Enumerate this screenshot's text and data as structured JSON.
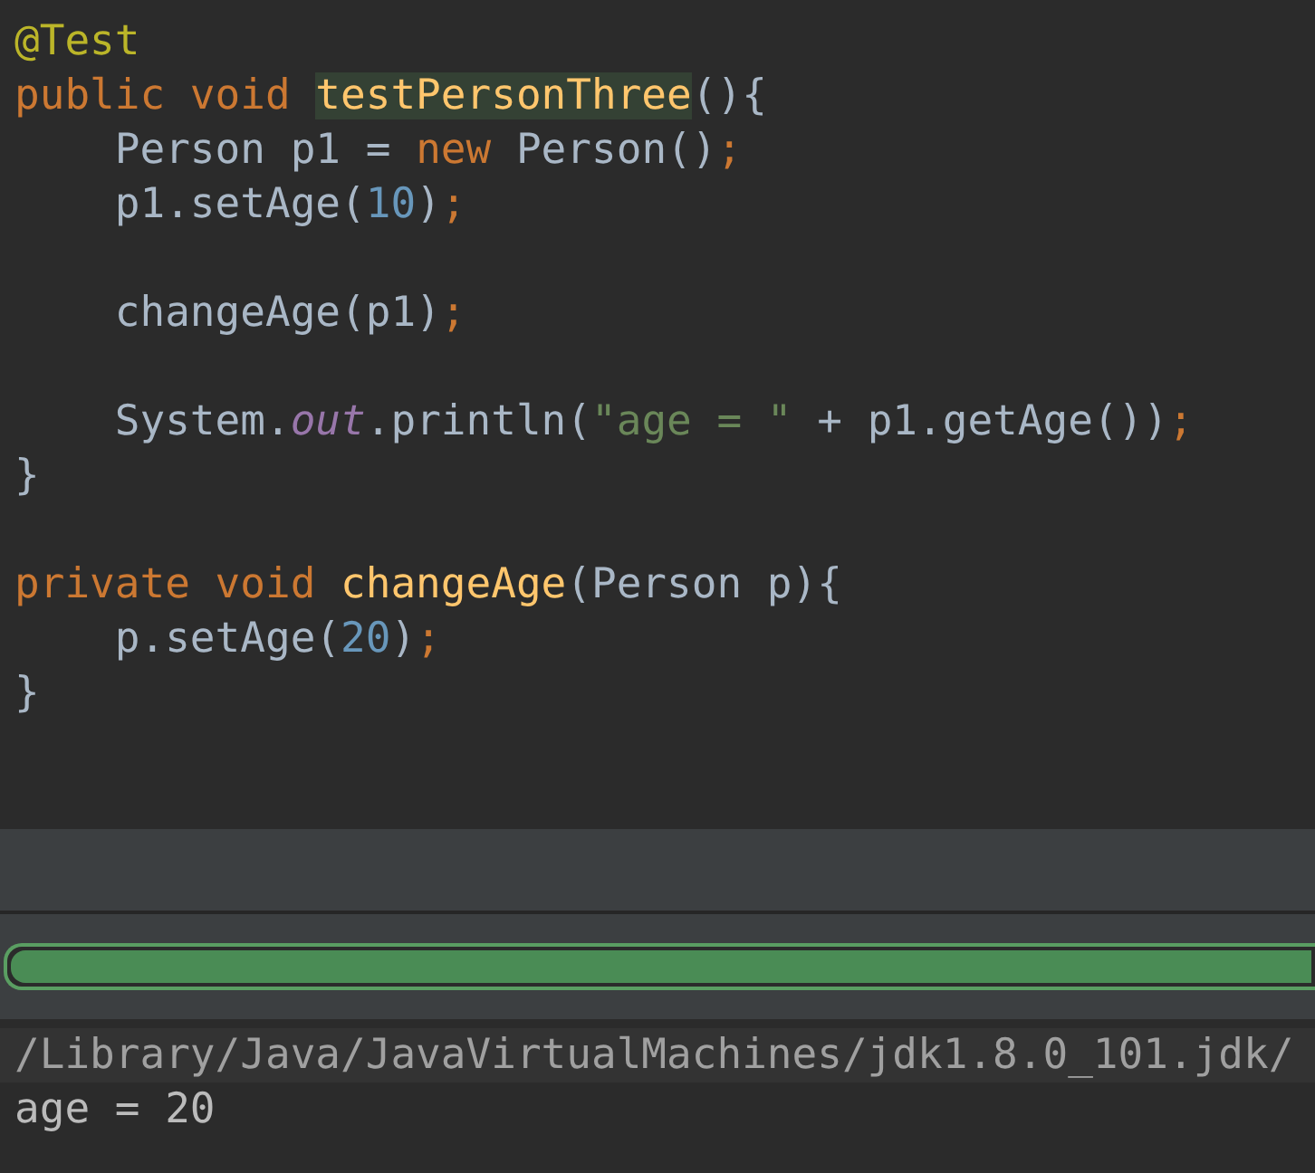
{
  "editor": {
    "lines": [
      {
        "kind": "code",
        "tokens": [
          {
            "kind": "annotation",
            "text": "@Test"
          }
        ]
      },
      {
        "kind": "code",
        "tokens": [
          {
            "kind": "keyword",
            "text": "public void "
          },
          {
            "kind": "usage",
            "text": "testPersonThree"
          },
          {
            "kind": "plain",
            "text": "(){"
          }
        ]
      },
      {
        "kind": "code",
        "tokens": [
          {
            "kind": "plain",
            "text": "    Person p1 = "
          },
          {
            "kind": "keyword",
            "text": "new "
          },
          {
            "kind": "plain",
            "text": "Person()"
          },
          {
            "kind": "keyword",
            "text": ";"
          }
        ]
      },
      {
        "kind": "code",
        "tokens": [
          {
            "kind": "plain",
            "text": "    p1.setAge("
          },
          {
            "kind": "number",
            "text": "10"
          },
          {
            "kind": "plain",
            "text": ")"
          },
          {
            "kind": "keyword",
            "text": ";"
          }
        ]
      },
      {
        "kind": "blank"
      },
      {
        "kind": "code",
        "tokens": [
          {
            "kind": "plain",
            "text": "    changeAge(p1)"
          },
          {
            "kind": "keyword",
            "text": ";"
          }
        ]
      },
      {
        "kind": "blank"
      },
      {
        "kind": "code",
        "tokens": [
          {
            "kind": "plain",
            "text": "    System."
          },
          {
            "kind": "static",
            "text": "out"
          },
          {
            "kind": "plain",
            "text": ".println("
          },
          {
            "kind": "string",
            "text": "\"age = \""
          },
          {
            "kind": "plain",
            "text": " + p1.getAge())"
          },
          {
            "kind": "keyword",
            "text": ";"
          }
        ]
      },
      {
        "kind": "code",
        "tokens": [
          {
            "kind": "plain",
            "text": "}"
          }
        ]
      },
      {
        "kind": "blank"
      },
      {
        "kind": "code",
        "tokens": [
          {
            "kind": "keyword",
            "text": "private void "
          },
          {
            "kind": "method",
            "text": "changeAge"
          },
          {
            "kind": "plain",
            "text": "(Person p){"
          }
        ]
      },
      {
        "kind": "code",
        "tokens": [
          {
            "kind": "plain",
            "text": "    p.setAge("
          },
          {
            "kind": "number",
            "text": "20"
          },
          {
            "kind": "plain",
            "text": ")"
          },
          {
            "kind": "keyword",
            "text": ";"
          }
        ]
      },
      {
        "kind": "code",
        "tokens": [
          {
            "kind": "plain",
            "text": "}"
          }
        ]
      }
    ]
  },
  "progress": {
    "level": 1
  },
  "console": {
    "lines": [
      {
        "kind": "command",
        "text": "/Library/Java/JavaVirtualMachines/jdk1.8.0_101.jdk/"
      },
      {
        "kind": "output",
        "text": "age = 20"
      }
    ]
  }
}
